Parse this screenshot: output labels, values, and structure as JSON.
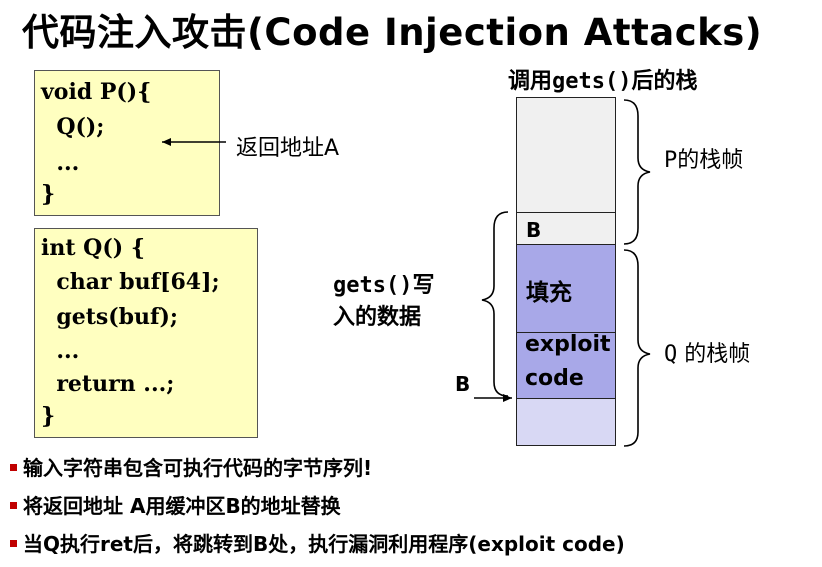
{
  "title": "代码注入攻击(Code Injection Attacks)",
  "code_p": {
    "lines": [
      "void P(){",
      "  Q();",
      "  ...",
      "}"
    ]
  },
  "code_q": {
    "lines": [
      "int Q() {",
      "  char buf[64];",
      "  gets(buf);",
      "  ...",
      "  return ...;",
      "}"
    ]
  },
  "return_addr_label": "返回地址A",
  "stack": {
    "heading_mono": "gets()",
    "heading_prefix": "调用",
    "heading_suffix": "后的栈",
    "cell_b": "B",
    "cell_fill": "填充",
    "cell_exploit_1": "exploit",
    "cell_exploit_2": "code",
    "p_frame_mono": "P",
    "p_frame_text": "的栈帧",
    "q_frame_mono": "Q",
    "q_frame_text": " 的栈帧",
    "gets_write_mono": "gets()",
    "gets_write_1": "写",
    "gets_write_2": "入的数据",
    "b_pointer": "B"
  },
  "bullets": [
    "输入字符串包含可执行代码的字节序列!",
    "将返回地址 A用缓冲区B的地址替换",
    "当Q执行ret后，将跳转到B处，执行漏洞利用程序(exploit code)"
  ],
  "colors": {
    "code_bg": "#ffffc0",
    "stack_top": "#f0f0f0",
    "stack_exploit": "#a8a8e8",
    "stack_bottom": "#d8d8f4",
    "bullet": "#c00000"
  }
}
